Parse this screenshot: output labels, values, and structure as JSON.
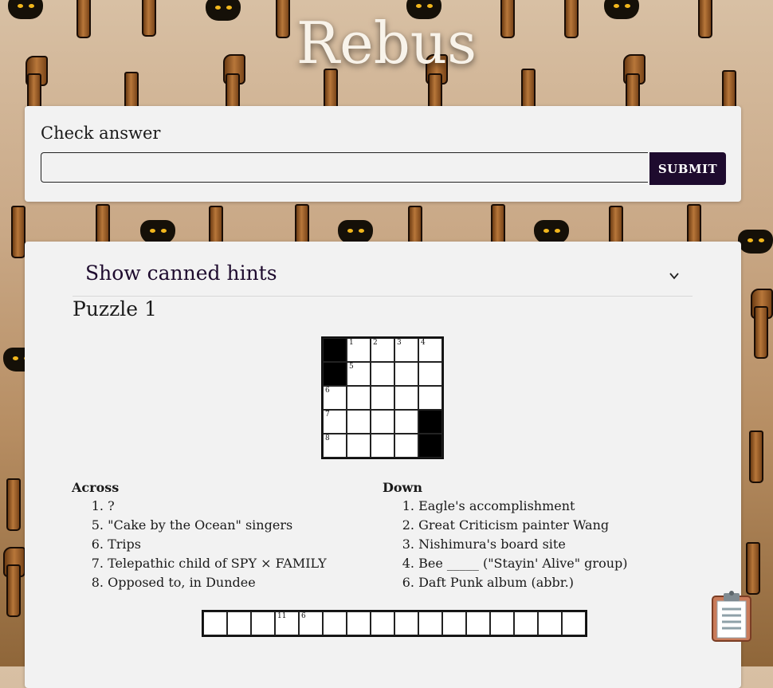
{
  "title": "Rebus",
  "check": {
    "label": "Check answer",
    "input_value": "",
    "submit_label": "SUBMIT"
  },
  "hints": {
    "toggle_label": "Show canned hints"
  },
  "puzzle": {
    "title": "Puzzle 1",
    "grid": [
      [
        {
          "black": true
        },
        {
          "num": "1"
        },
        {
          "num": "2"
        },
        {
          "num": "3"
        },
        {
          "num": "4"
        }
      ],
      [
        {
          "black": true
        },
        {
          "num": "5"
        },
        {},
        {},
        {}
      ],
      [
        {
          "num": "6"
        },
        {},
        {},
        {},
        {}
      ],
      [
        {
          "num": "7"
        },
        {},
        {},
        {},
        {
          "black": true
        }
      ],
      [
        {
          "num": "8"
        },
        {},
        {},
        {},
        {
          "black": true
        }
      ]
    ],
    "across": {
      "heading": "Across",
      "clues": [
        {
          "num": "1.",
          "text": "?"
        },
        {
          "num": "5.",
          "text": "\"Cake by the Ocean\" singers"
        },
        {
          "num": "6.",
          "text": "Trips"
        },
        {
          "num": "7.",
          "text": "Telepathic child of SPY × FAMILY"
        },
        {
          "num": "8.",
          "text": "Opposed to, in Dundee"
        }
      ]
    },
    "down": {
      "heading": "Down",
      "clues": [
        {
          "num": "1.",
          "text": "Eagle's accomplishment"
        },
        {
          "num": "2.",
          "text": "Great Criticism painter Wang"
        },
        {
          "num": "3.",
          "text": "Nishimura's board site"
        },
        {
          "num": "4.",
          "text": "Bee _____ (\"Stayin' Alive\" group)"
        },
        {
          "num": "6.",
          "text": "Daft Punk album (abbr.)"
        }
      ]
    },
    "answer_strip": [
      "",
      "",
      "",
      "11",
      "6",
      "",
      "",
      "",
      "",
      "",
      "",
      "",
      "",
      "",
      "",
      ""
    ]
  },
  "icons": {
    "chevron": "chevron-down-icon",
    "clipboard": "clipboard-icon"
  },
  "colors": {
    "accent": "#1e0b2e",
    "card": "#f2f2f2"
  }
}
